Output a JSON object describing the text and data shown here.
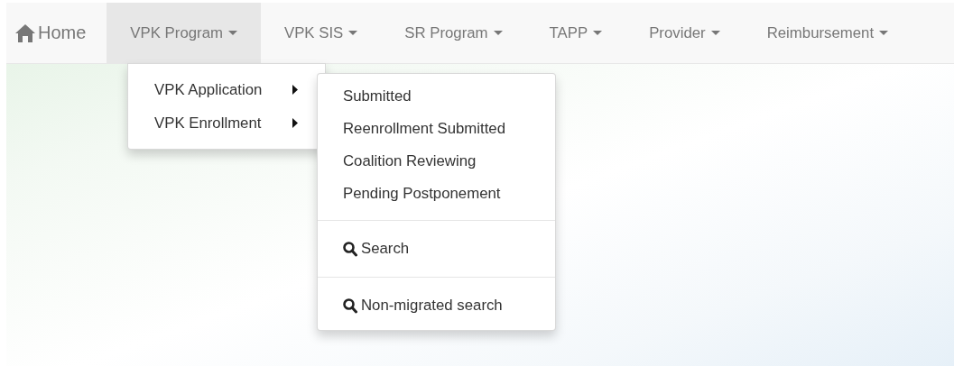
{
  "navbar": {
    "items": [
      {
        "kind": "home",
        "label": "Home",
        "selected": false
      },
      {
        "kind": "dropdown",
        "label": "VPK Program",
        "selected": true
      },
      {
        "kind": "dropdown",
        "label": "VPK SIS",
        "selected": false
      },
      {
        "kind": "dropdown",
        "label": "SR Program",
        "selected": false
      },
      {
        "kind": "dropdown",
        "label": "TAPP",
        "selected": false
      },
      {
        "kind": "dropdown",
        "label": "Provider",
        "selected": false
      },
      {
        "kind": "dropdown",
        "label": "Reimbursement",
        "selected": false
      }
    ]
  },
  "dropdown_menu": {
    "items": [
      {
        "kind": "submenu",
        "label": "VPK Application"
      },
      {
        "kind": "submenu",
        "label": "VPK Enrollment"
      }
    ]
  },
  "submenu": {
    "items": [
      {
        "kind": "link",
        "label": "Submitted"
      },
      {
        "kind": "link",
        "label": "Reenrollment Submitted"
      },
      {
        "kind": "link",
        "label": "Coalition Reviewing"
      },
      {
        "kind": "link",
        "label": "Pending Postponement"
      },
      {
        "kind": "divider"
      },
      {
        "kind": "search",
        "label": "Search"
      },
      {
        "kind": "divider"
      },
      {
        "kind": "search",
        "label": "Non-migrated search"
      }
    ]
  }
}
